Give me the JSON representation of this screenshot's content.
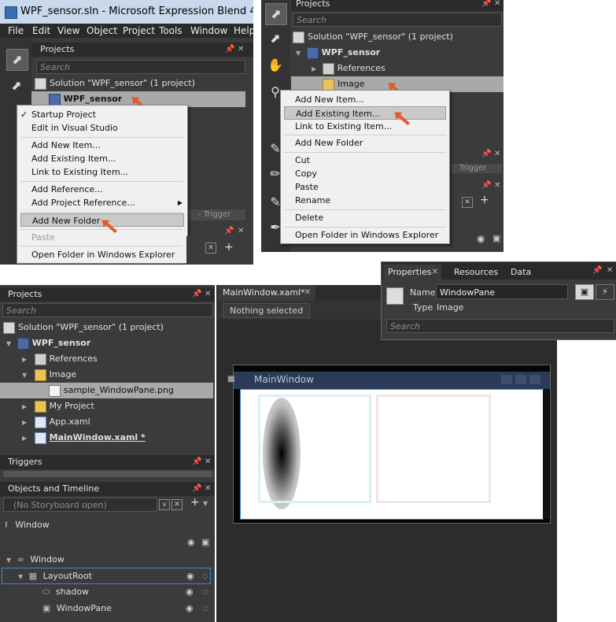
{
  "shot1": {
    "window_title": "WPF_sensor.sln - Microsoft Expression Blend 4",
    "menubar": [
      "File",
      "Edit",
      "View",
      "Object",
      "Project",
      "Tools",
      "Window",
      "Help"
    ],
    "panel_title": "Projects",
    "search_placeholder": "Search",
    "solution_label": "Solution \"WPF_sensor\" (1 project)",
    "project_label": "WPF_sensor",
    "trigger_label": "- Trigger",
    "context_menu": [
      {
        "label": "Startup Project",
        "checked": true
      },
      {
        "label": "Edit in Visual Studio"
      },
      {
        "label": "Add New Item..."
      },
      {
        "label": "Add Existing Item..."
      },
      {
        "label": "Link to Existing Item..."
      },
      {
        "label": "Add Reference..."
      },
      {
        "label": "Add Project Reference...",
        "submenu": true
      },
      {
        "label": "Add New Folder",
        "highlighted": true
      },
      {
        "label": "Paste",
        "disabled": true
      },
      {
        "label": "Open Folder in Windows Explorer"
      }
    ]
  },
  "shot2": {
    "panel_title": "Projects",
    "search_placeholder": "Search",
    "solution_label": "Solution \"WPF_sensor\" (1 project)",
    "project_label": "WPF_sensor",
    "references_label": "References",
    "image_folder_label": "Image",
    "trigger_label": "Trigger",
    "context_menu": [
      {
        "label": "Add New Item..."
      },
      {
        "label": "Add Existing Item...",
        "highlighted": true
      },
      {
        "label": "Link to Existing Item..."
      },
      {
        "label": "Add New Folder"
      },
      {
        "label": "Cut"
      },
      {
        "label": "Copy"
      },
      {
        "label": "Paste"
      },
      {
        "label": "Rename"
      },
      {
        "label": "Delete"
      },
      {
        "label": "Open Folder in Windows Explorer"
      }
    ]
  },
  "shot3": {
    "properties": {
      "tabs": [
        "Properties",
        "Resources",
        "Data"
      ],
      "name_label": "Name",
      "name_value": "WindowPane",
      "type_label": "Type",
      "type_value": "Image",
      "search_placeholder": "Search"
    },
    "projects": {
      "title": "Projects",
      "search_placeholder": "Search",
      "tree": [
        {
          "label": "Solution \"WPF_sensor\" (1 project)"
        },
        {
          "label": "WPF_sensor"
        },
        {
          "label": "References"
        },
        {
          "label": "Image"
        },
        {
          "label": "sample_WindowPane.png"
        },
        {
          "label": "My Project"
        },
        {
          "label": "App.xaml"
        },
        {
          "label": "MainWindow.xaml *"
        }
      ]
    },
    "triggers_title": "Triggers",
    "objects": {
      "title": "Objects and Timeline",
      "storyboard": "(No Storyboard open)",
      "items": [
        {
          "label": "Window"
        },
        {
          "label": "Window"
        },
        {
          "label": "LayoutRoot"
        },
        {
          "label": "shadow"
        },
        {
          "label": "WindowPane"
        }
      ]
    },
    "document": {
      "tab_label": "MainWindow.xaml*",
      "selection_status": "Nothing selected",
      "artboard_title": "MainWindow"
    }
  }
}
